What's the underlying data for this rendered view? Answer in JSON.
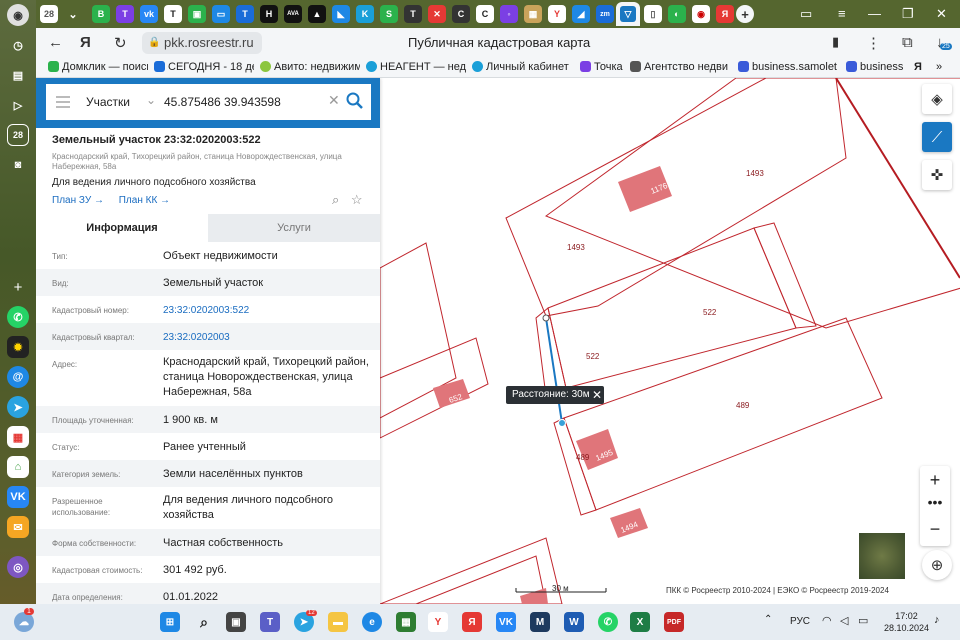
{
  "browser": {
    "tab_count_badge": "28",
    "url": "pkk.rosreestr.ru",
    "page_title": "Публичная кадастровая карта",
    "downloads_badge": "25",
    "bookmarks": [
      {
        "label": "Домклик — поиск",
        "color": "#2bb24c"
      },
      {
        "label": "СЕГОДНЯ - 18 дек",
        "color": "#1a6cd8"
      },
      {
        "label": "Авито: недвижим",
        "color": "#8cc63f"
      },
      {
        "label": "НЕАГЕНТ — недв",
        "color": "#1a9fd8"
      },
      {
        "label": "Личный кабинет",
        "color": "#1a9fd8"
      },
      {
        "label": "Точка",
        "color": "#7b3fe4"
      },
      {
        "label": "Агентство недвиж",
        "color": "#555555"
      },
      {
        "label": "business.samolet",
        "color": "#3a5bd9"
      },
      {
        "label": "business",
        "color": "#3a5bd9"
      }
    ]
  },
  "search": {
    "type_label": "Участки",
    "query": "45.875486 39.943598"
  },
  "parcel": {
    "title": "Земельный участок 23:32:0202003:522",
    "address_short": "Краснодарский край, Тихорецкий район, станица Новорождественская, улица Набережная, 58а",
    "usage": "Для ведения личного подсобного хозяйства",
    "plan_zu": "План ЗУ →",
    "plan_kk": "План КК →"
  },
  "tabs": {
    "info": "Информация",
    "services": "Услуги"
  },
  "rows": [
    {
      "key": "Тип:",
      "value": "Объект недвижимости"
    },
    {
      "key": "Вид:",
      "value": "Земельный участок"
    },
    {
      "key": "Кадастровый номер:",
      "value": "23:32:0202003:522",
      "link": true
    },
    {
      "key": "Кадастровый квартал:",
      "value": "23:32:0202003",
      "link": true
    },
    {
      "key": "Адрес:",
      "value": "Краснодарский край, Тихорецкий район, станица Новорождественская, улица Набережная, 58а"
    },
    {
      "key": "Площадь уточненная:",
      "value": "1 900 кв. м"
    },
    {
      "key": "Статус:",
      "value": "Ранее учтенный"
    },
    {
      "key": "Категория земель:",
      "value": "Земли населённых пунктов"
    },
    {
      "key": "Разрешенное использование:",
      "value": "Для ведения личного подсобного хозяйства"
    },
    {
      "key": "Форма собственности:",
      "value": "Частная собственность"
    },
    {
      "key": "Кадастровая стоимость:",
      "value": "301 492 руб."
    },
    {
      "key": "Дата определения:",
      "value": "01.01.2022"
    }
  ],
  "map": {
    "labels": [
      "1493",
      "1176",
      "1493",
      "522",
      "522",
      "652",
      "489",
      "489",
      "1495",
      "1494"
    ],
    "tooltip": "Расстояние: 30м",
    "scale_label": "30 м",
    "copyright": "ПКК © Росреестр 2010-2024 | ЕЭКО © Росреестр 2019-2024",
    "parcel_color": "#c0262d"
  },
  "taskbar": {
    "language": "РУС",
    "time": "17:02",
    "date": "28.10.2024",
    "notif_badge": "1",
    "telegram_badge": "12"
  }
}
